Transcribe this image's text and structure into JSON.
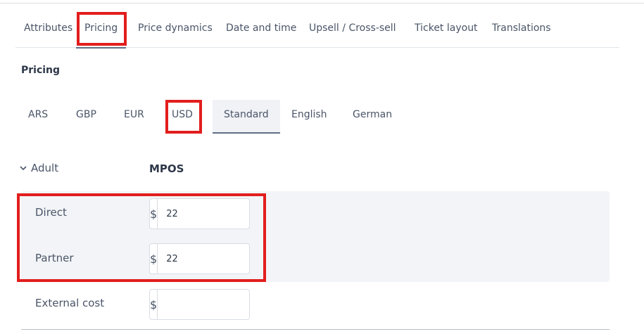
{
  "tabs": [
    {
      "label": "Attributes"
    },
    {
      "label": "Pricing"
    },
    {
      "label": "Price dynamics"
    },
    {
      "label": "Date and time"
    },
    {
      "label": "Upsell / Cross-sell"
    },
    {
      "label": "Ticket layout"
    },
    {
      "label": "Translations"
    }
  ],
  "active_tab": "Pricing",
  "section": {
    "title": "Pricing"
  },
  "currencies": [
    {
      "label": "ARS"
    },
    {
      "label": "GBP"
    },
    {
      "label": "EUR"
    },
    {
      "label": "USD"
    }
  ],
  "price_lists": [
    {
      "label": "Standard"
    },
    {
      "label": "English"
    },
    {
      "label": "German"
    }
  ],
  "selected_price_list": "Standard",
  "group": {
    "label": "Adult",
    "column_header": "MPOS"
  },
  "rows": [
    {
      "label": "Direct",
      "currency_symbol": "$",
      "value": "22"
    },
    {
      "label": "Partner",
      "currency_symbol": "$",
      "value": "22"
    },
    {
      "label": "External cost",
      "currency_symbol": "$",
      "value": ""
    }
  ],
  "colors": {
    "highlight": "#e21d1d",
    "accent": "#5e6f86",
    "block_bg": "#f2f4f7"
  }
}
